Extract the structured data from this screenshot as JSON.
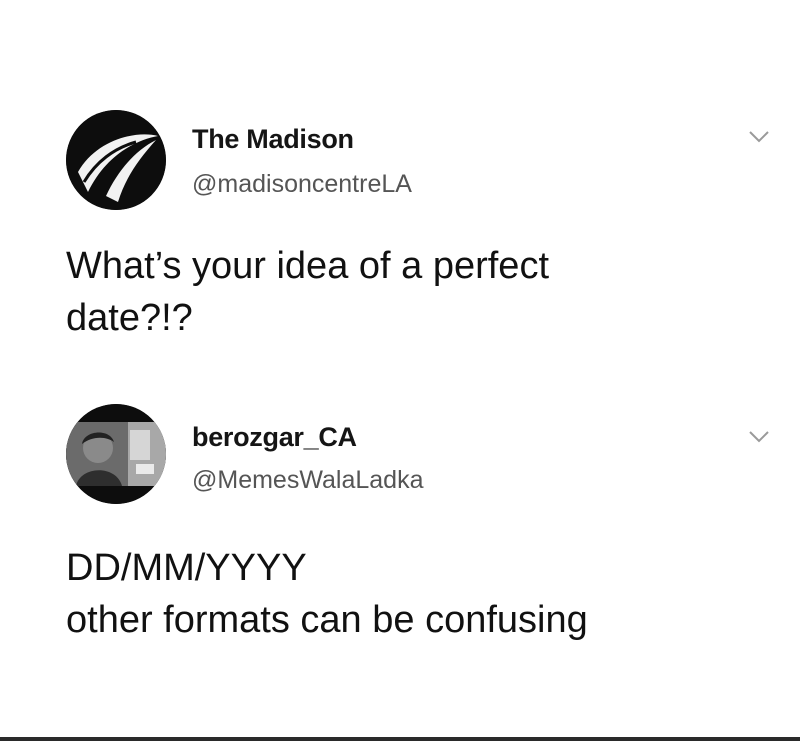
{
  "tweets": [
    {
      "display_name": "The Madison",
      "handle": "@madisoncentreLA",
      "text_lines": [
        "What’s your idea of a perfect",
        "date?!?"
      ],
      "avatar_icon": "madison-logo-icon",
      "menu_icon": "chevron-down-icon"
    },
    {
      "display_name": "berozgar_CA",
      "handle": "@MemesWalaLadka",
      "text_lines": [
        "DD/MM/YYYY",
        "other formats can be confusing"
      ],
      "avatar_icon": "profile-photo",
      "menu_icon": "chevron-down-icon"
    }
  ],
  "colors": {
    "background": "#ffffff",
    "text": "#111111",
    "handle": "#555555",
    "chevron": "#9a9a9a"
  }
}
